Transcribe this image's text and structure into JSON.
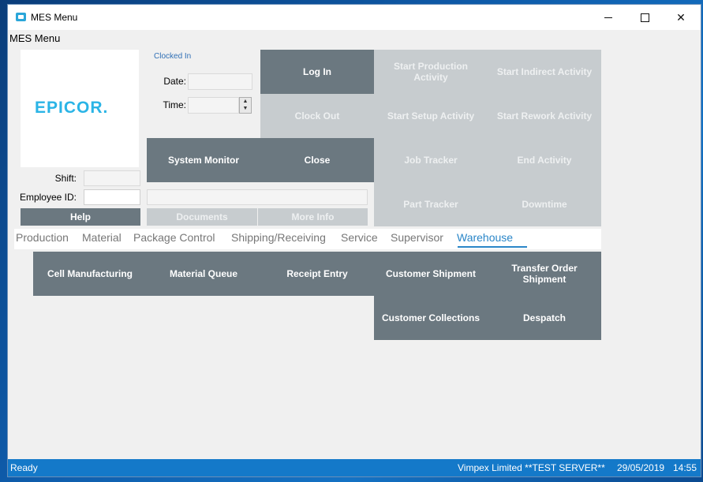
{
  "window": {
    "title": "MES Menu"
  },
  "menubar": {
    "label": "MES Menu"
  },
  "logo": {
    "text": "EPICOR."
  },
  "clock": {
    "status": "Clocked In",
    "date_label": "Date:",
    "time_label": "Time:",
    "shift_label": "Shift:",
    "employee_label": "Employee ID:"
  },
  "buttons": {
    "login": "Log In",
    "clock_out": "Clock Out",
    "system_monitor": "System Monitor",
    "close": "Close",
    "help": "Help",
    "documents": "Documents",
    "more_info": "More Info",
    "start_production": "Start Production Activity",
    "start_indirect": "Start Indirect Activity",
    "start_setup": "Start Setup Activity",
    "start_rework": "Start Rework Activity",
    "job_tracker": "Job Tracker",
    "end_activity": "End Activity",
    "part_tracker": "Part Tracker",
    "downtime": "Downtime"
  },
  "tabs": [
    "Production",
    "Material",
    "Package Control",
    "Shipping/Receiving",
    "Service",
    "Supervisor",
    "Warehouse"
  ],
  "active_tab": "Warehouse",
  "warehouse": {
    "cell_manufacturing": "Cell Manufacturing",
    "material_queue": "Material Queue",
    "receipt_entry": "Receipt Entry",
    "customer_shipment": "Customer Shipment",
    "transfer_order_shipment": "Transfer Order Shipment",
    "customer_collections": "Customer Collections",
    "despatch": "Despatch"
  },
  "status": {
    "left": "Ready",
    "company": "Vimpex Limited **TEST SERVER**",
    "date": "29/05/2019",
    "time": "14:55"
  },
  "colors": {
    "tile_dark": "#6b7880",
    "tile_disabled": "#c7cccf",
    "accent": "#2a86c8",
    "status_bar": "#1479c9"
  }
}
